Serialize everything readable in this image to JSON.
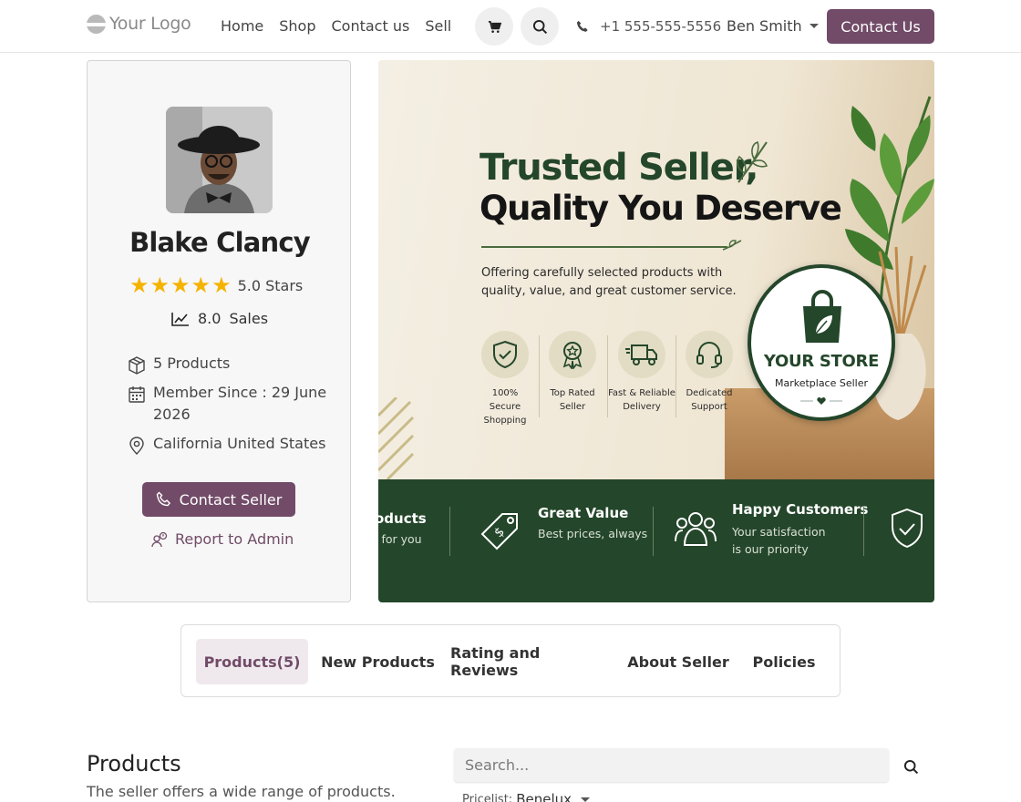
{
  "header": {
    "logo_text": "Your Logo",
    "nav": [
      "Home",
      "Shop",
      "Contact us",
      "Sell"
    ],
    "phone": "+1 555-555-5556",
    "user": "Ben Smith",
    "contact_button": "Contact Us",
    "icons": [
      "cart-icon",
      "search-icon",
      "phone-icon"
    ]
  },
  "seller": {
    "name": "Blake Clancy",
    "stars": "★★★★★",
    "rating_text": "5.0 Stars",
    "sales_value": "8.0",
    "sales_label": "Sales",
    "products": "5 Products",
    "member_since": "Member Since : 29 June 2026",
    "location": "California United States",
    "contact_button": "Contact Seller",
    "report_link": "Report to Admin"
  },
  "banner": {
    "headline1": "Trusted Seller,",
    "headline2": "Quality You Deserve",
    "tagline": "Offering carefully selected products with quality, value, and great customer service.",
    "features": [
      {
        "line1": "100%",
        "line2": "Secure Shopping"
      },
      {
        "line1": "Top Rated",
        "line2": "Seller"
      },
      {
        "line1": "Fast & Reliable",
        "line2": "Delivery"
      },
      {
        "line1": "Dedicated",
        "line2": "Support"
      }
    ],
    "badge_title": "YOUR STORE",
    "badge_sub": "Marketplace Seller",
    "strip": [
      {
        "title": "oducts",
        "desc": "l for you"
      },
      {
        "title": "Great Value",
        "desc": "Best prices, always"
      },
      {
        "title": "Happy Customers",
        "desc1": "Your satisfaction",
        "desc2": "is our priority"
      }
    ]
  },
  "tabs": [
    "Products(5)",
    "New Products",
    "Rating and Reviews",
    "About Seller",
    "Policies"
  ],
  "products": {
    "title": "Products",
    "description": "The seller offers a wide range of products.",
    "search_placeholder": "Search...",
    "pricelist_label": "Pricelist:",
    "pricelist_value": "Benelux"
  },
  "colors": {
    "brand": "#714b67",
    "banner_green": "#24462a",
    "star": "#f5b301"
  }
}
